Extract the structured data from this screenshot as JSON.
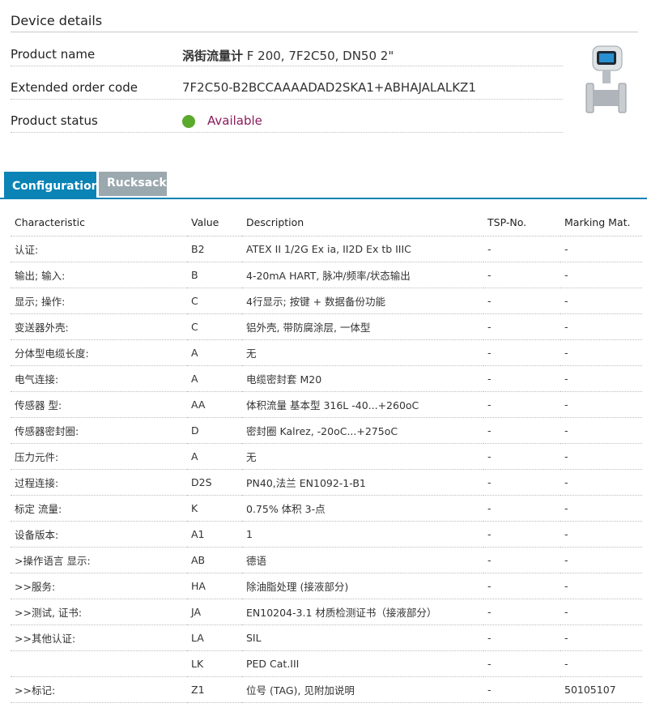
{
  "header": {
    "title": "Device details",
    "product_name_label": "Product name",
    "product_name_bold": "涡街流量计",
    "product_name_rest": " F 200, 7F2C50, DN50 2\"",
    "order_code_label": "Extended order code",
    "order_code_value": "7F2C50-B2BCCAAAADAD2SKA1+ABHAJALALKZ1",
    "status_label": "Product status",
    "status_value": "Available",
    "status_color": "#5aaa2c",
    "status_text_color": "#8a1c5c",
    "device_image_icon": "flowmeter-device-image"
  },
  "tabs": [
    {
      "label": "Configuration",
      "active": true
    },
    {
      "label": "Rucksack",
      "active": false
    }
  ],
  "colors": {
    "tab_active": "#0b83b5",
    "tab_inactive": "#9ba8ae"
  },
  "table": {
    "headers": [
      "Characteristic",
      "Value",
      "Description",
      "TSP-No.",
      "Marking Mat."
    ],
    "rows": [
      [
        "认证:",
        "B2",
        "ATEX II 1/2G Ex ia, II2D Ex tb IIIC",
        "-",
        "-"
      ],
      [
        "输出; 输入:",
        "B",
        "4-20mA HART, 脉冲/频率/状态输出",
        "-",
        "-"
      ],
      [
        "显示; 操作:",
        "C",
        "4行显示; 按键 + 数据备份功能",
        "-",
        "-"
      ],
      [
        "变送器外壳:",
        "C",
        "铝外壳, 带防腐涂层, 一体型",
        "-",
        "-"
      ],
      [
        "分体型电缆长度:",
        "A",
        "无",
        "-",
        "-"
      ],
      [
        "电气连接:",
        "A",
        "电缆密封套 M20",
        "-",
        "-"
      ],
      [
        "传感器 型:",
        "AA",
        "体积流量 基本型 316L -40...+260oC",
        "-",
        "-"
      ],
      [
        "传感器密封圈:",
        "D",
        "密封圈 Kalrez, -20oC...+275oC",
        "-",
        "-"
      ],
      [
        "压力元件:",
        "A",
        "无",
        "-",
        "-"
      ],
      [
        "过程连接:",
        "D2S",
        "PN40,法兰 EN1092-1-B1",
        "-",
        "-"
      ],
      [
        "标定 流量:",
        "K",
        "0.75% 体积 3-点",
        "-",
        "-"
      ],
      [
        "设备版本:",
        "A1",
        "1",
        "-",
        "-"
      ],
      [
        ">操作语言 显示:",
        "AB",
        "德语",
        "-",
        "-"
      ],
      [
        ">>服务:",
        "HA",
        "除油脂处理 (接液部分)",
        "-",
        "-"
      ],
      [
        ">>测试, 证书:",
        "JA",
        "EN10204-3.1 材质检测证书（接液部分）",
        "-",
        "-"
      ],
      [
        ">>其他认证:",
        "LA",
        "SIL",
        "-",
        "-"
      ],
      [
        "",
        "LK",
        "PED Cat.III",
        "-",
        "-"
      ],
      [
        ">>标记:",
        "Z1",
        "位号 (TAG), 见附加说明",
        "-",
        "50105107"
      ]
    ]
  }
}
